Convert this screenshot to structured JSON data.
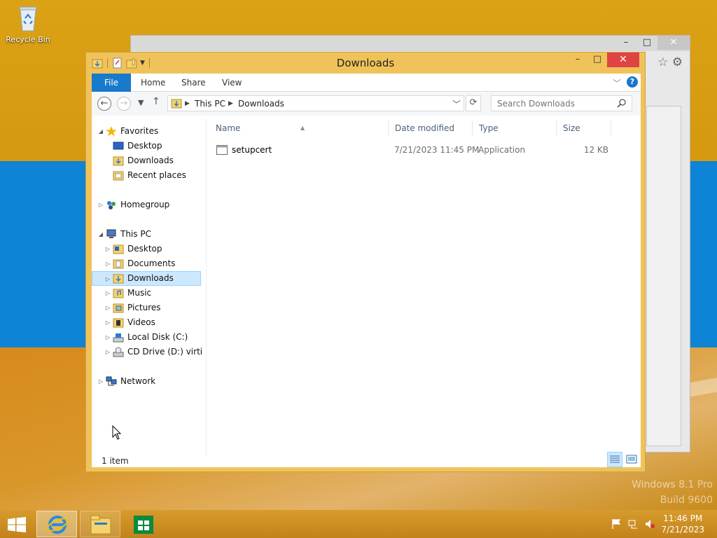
{
  "desktop": {
    "recycle_bin_label": "Recycle Bin",
    "watermark_line1": "Windows 8.1 Pro",
    "watermark_line2": "Build 9600"
  },
  "explorer": {
    "title": "Downloads",
    "minimize": "–",
    "maximize": "□",
    "close": "✕",
    "ribbon_tabs": [
      "File",
      "Home",
      "Share",
      "View"
    ],
    "help": "?",
    "breadcrumb": [
      "This PC",
      "Downloads"
    ],
    "search_placeholder": "Search Downloads",
    "nav": {
      "favorites": "Favorites",
      "fav_items": [
        "Desktop",
        "Downloads",
        "Recent places"
      ],
      "homegroup": "Homegroup",
      "this_pc": "This PC",
      "pc_items": [
        "Desktop",
        "Documents",
        "Downloads",
        "Music",
        "Pictures",
        "Videos",
        "Local Disk (C:)",
        "CD Drive (D:) virtio-v"
      ],
      "network": "Network",
      "selected": "Downloads"
    },
    "columns": [
      "Name",
      "Date modified",
      "Type",
      "Size"
    ],
    "files": [
      {
        "name": "setupcert",
        "date": "7/21/2023 11:45 PM",
        "type": "Application",
        "size": "12 KB"
      }
    ],
    "status": "1 item"
  },
  "taskbar": {
    "time": "11:46 PM",
    "date": "7/21/2023"
  },
  "colors": {
    "accent": "#1979ca",
    "window_frame": "#f0c35a",
    "close_red": "#e04343",
    "desktop_blue": "#0e84d6",
    "selection": "#cce8ff"
  }
}
